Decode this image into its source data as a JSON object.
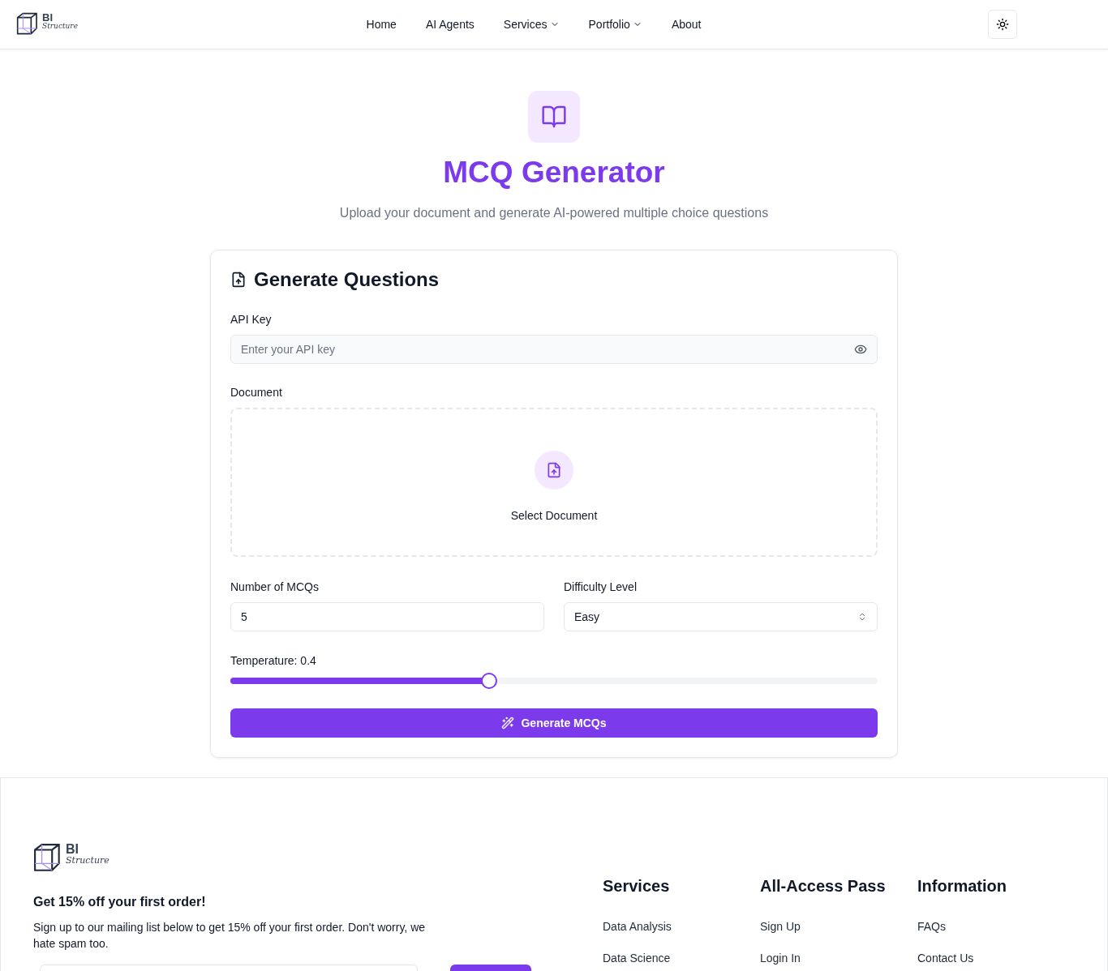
{
  "header": {
    "logo": {
      "title": "BI",
      "subtitle": "Structure"
    },
    "nav": [
      {
        "label": "Home",
        "has_menu": false
      },
      {
        "label": "AI Agents",
        "has_menu": false
      },
      {
        "label": "Services",
        "has_menu": true
      },
      {
        "label": "Portfolio",
        "has_menu": true
      },
      {
        "label": "About",
        "has_menu": false
      }
    ]
  },
  "hero": {
    "title": "MCQ Generator",
    "subtitle": "Upload your document and generate AI-powered multiple choice questions"
  },
  "form": {
    "title": "Generate Questions",
    "api_key": {
      "label": "API Key",
      "placeholder": "Enter your API key"
    },
    "document": {
      "label": "Document",
      "action": "Select Document"
    },
    "count": {
      "label": "Number of MCQs",
      "value": "5"
    },
    "difficulty": {
      "label": "Difficulty Level",
      "value": "Easy"
    },
    "temperature": {
      "label": "Temperature: 0.4",
      "level": 0.4
    },
    "submit": "Generate MCQs"
  },
  "footer": {
    "logo": {
      "title": "BI",
      "subtitle": "Structure"
    },
    "offer": {
      "title": "Get 15% off your first order!",
      "text": "Sign up to our mailing list below to get 15% off your first order. Don't worry, we hate spam too."
    },
    "columns": [
      {
        "title": "Services",
        "links": [
          "Data Analysis",
          "Data Science"
        ]
      },
      {
        "title": "All-Access Pass",
        "links": [
          "Sign Up",
          "Login In"
        ]
      },
      {
        "title": "Information",
        "links": [
          "FAQs",
          "Contact Us"
        ]
      }
    ]
  }
}
